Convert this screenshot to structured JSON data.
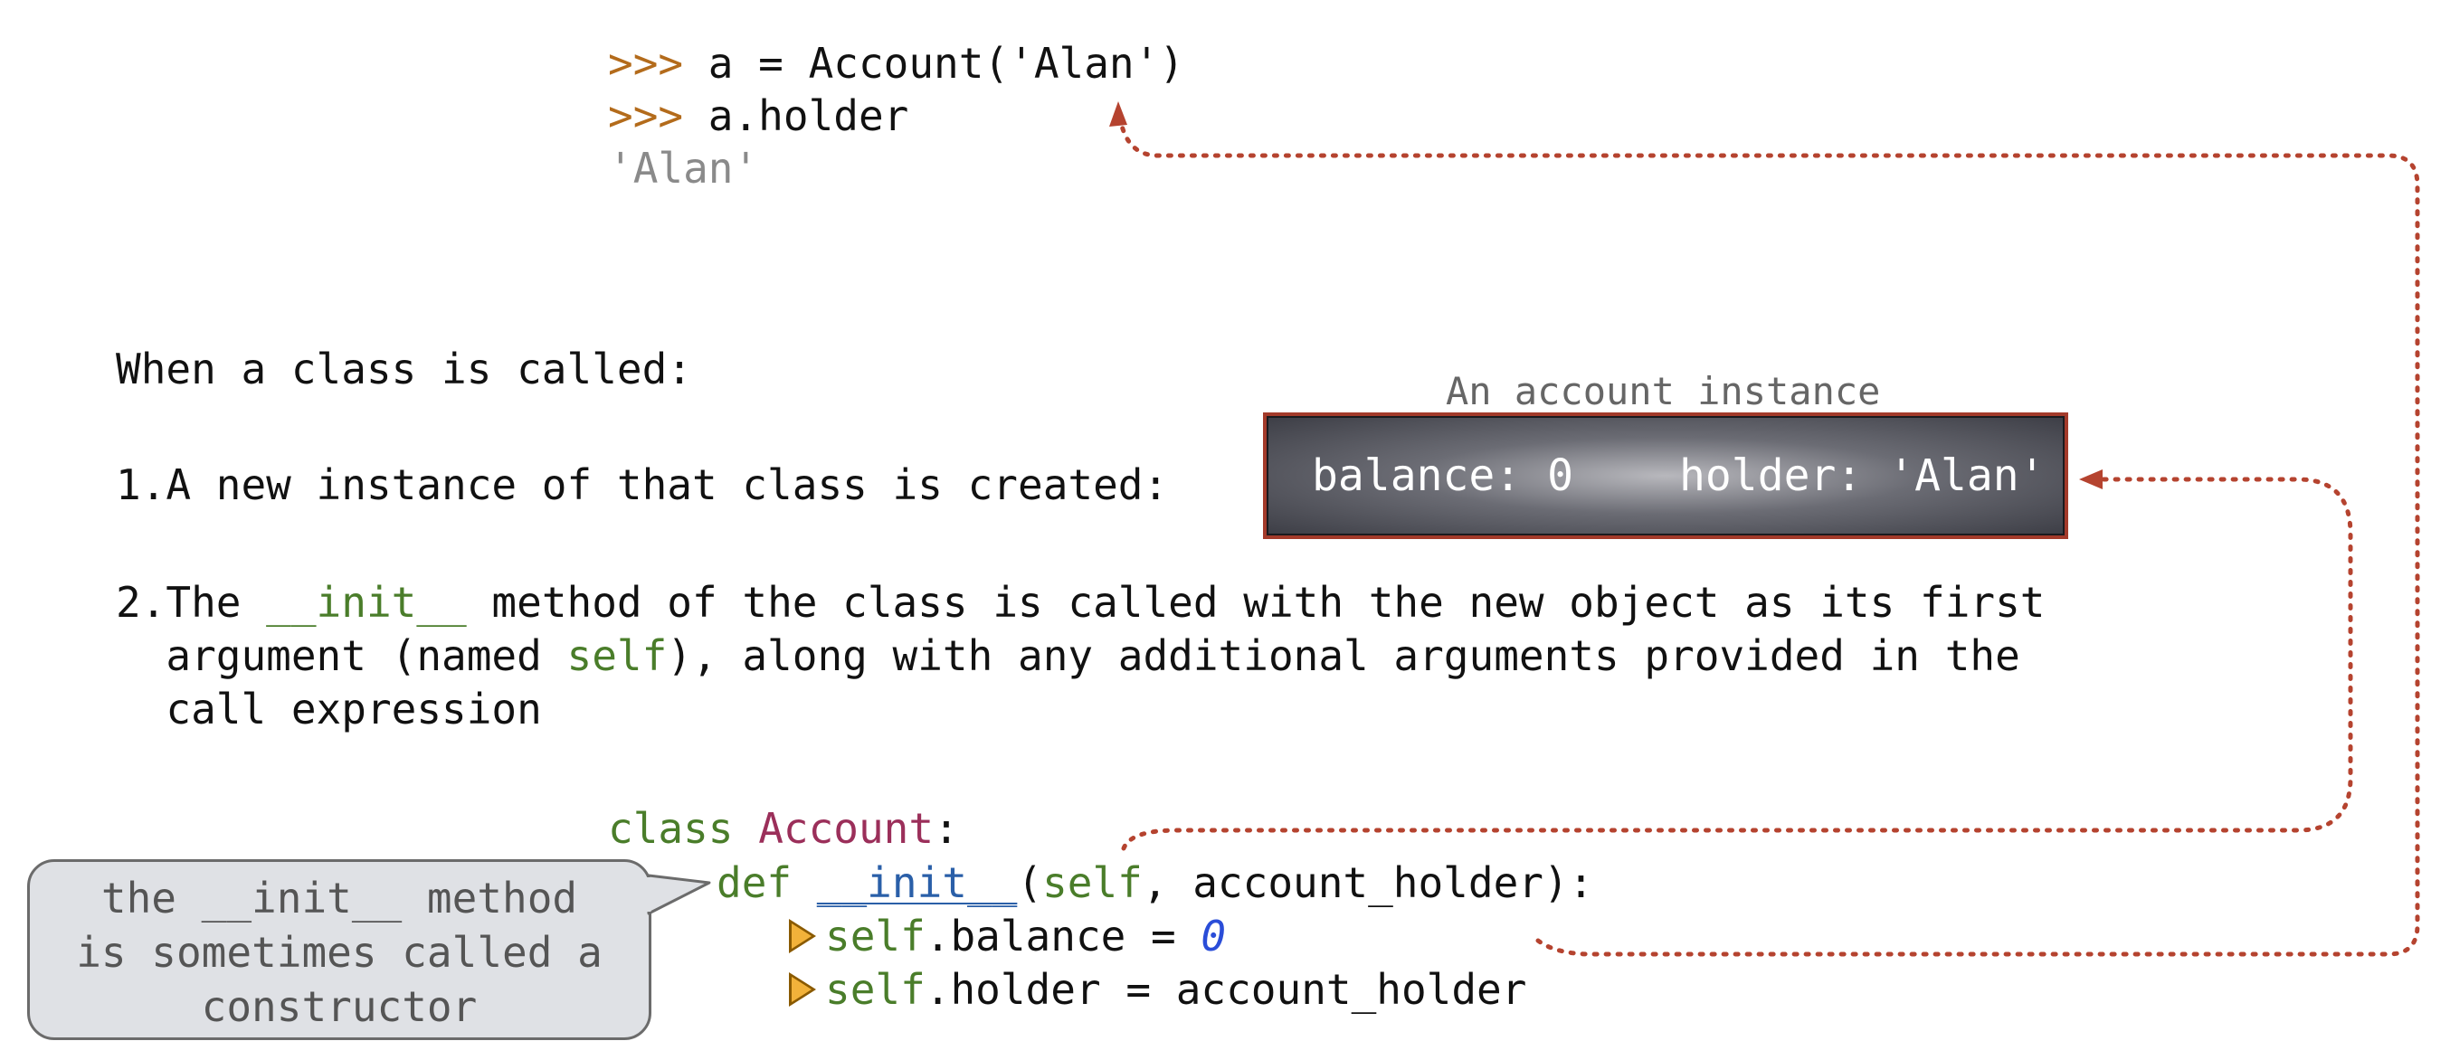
{
  "console": {
    "prompt": ">>>",
    "line1_code": "a = Account('Alan')",
    "line2_code": "a.holder",
    "output": "'Alan'"
  },
  "explanation": {
    "intro": "When a class is called:",
    "step1": "1.A new instance of that class is created:",
    "step2": {
      "prefix": "2.The ",
      "init": "__init__",
      "middle": " method of the class is called with the new object as its first",
      "line2_a": "  argument (named ",
      "self": "self",
      "line2_b": "), along with any additional arguments provided in the",
      "line3": "  call expression"
    }
  },
  "instance": {
    "label": "An account instance",
    "balance": "balance: 0",
    "holder": "holder: 'Alan'"
  },
  "code": {
    "class_kw": "class",
    "class_name": "Account",
    "colon": ":",
    "def_kw": "def",
    "init_name": "__init__",
    "open_paren": "(",
    "self_param": "self",
    "params_rest": ", account_holder):",
    "balance_self": "self",
    "balance_rest": ".balance = ",
    "balance_value": "0",
    "holder_self": "self",
    "holder_rest": ".holder = account_holder"
  },
  "callout": {
    "lines": [
      "the __init__ method",
      "is sometimes called a",
      "constructor"
    ]
  },
  "colors": {
    "arrow": "#b5432f",
    "prompt": "#b36b1b",
    "keyword": "#4a7d2a",
    "class_name": "#9b2f5a",
    "function_name": "#2a5fa8",
    "number": "#2a4dd8",
    "marker": "#f2b23a"
  },
  "icons": [
    "play-marker-icon",
    "arrowhead-icon"
  ]
}
